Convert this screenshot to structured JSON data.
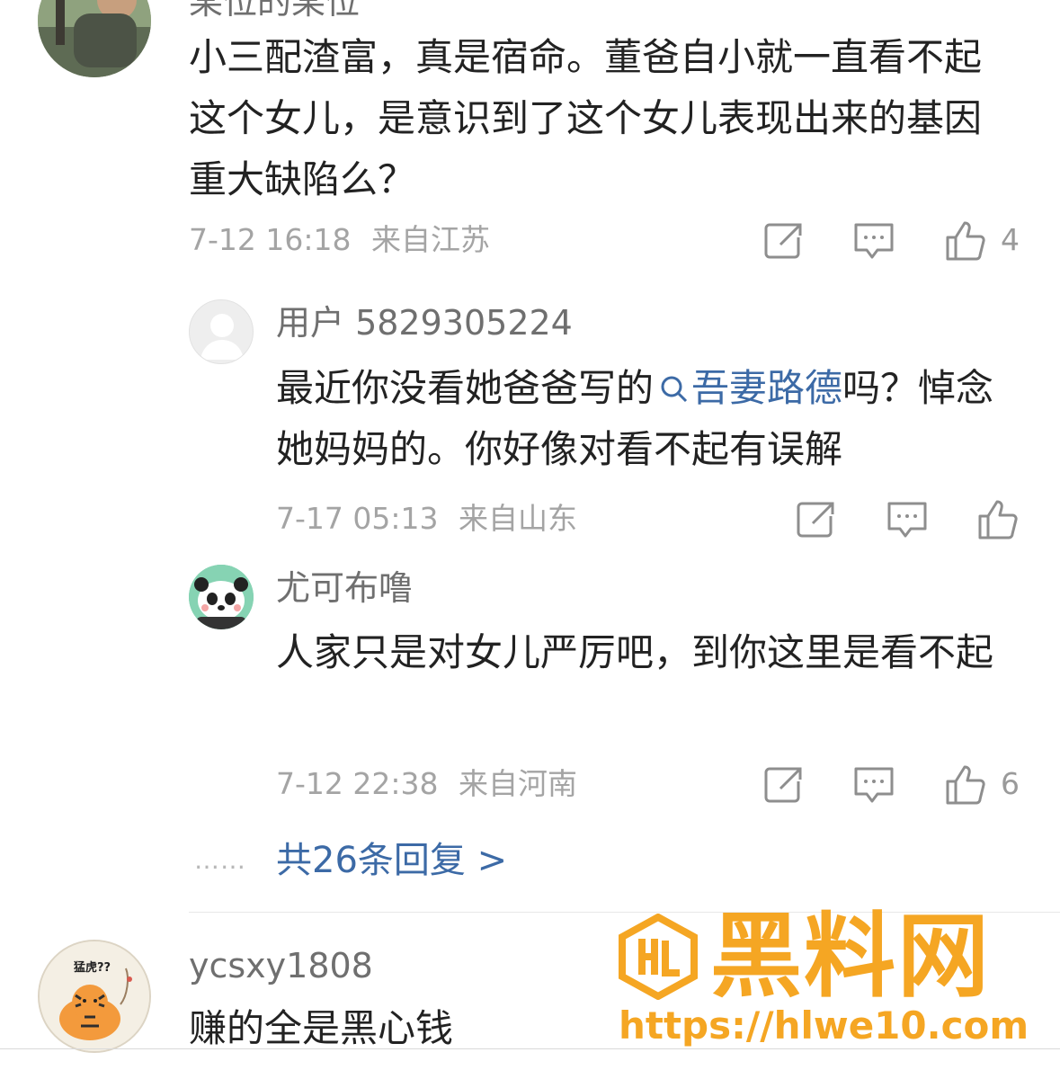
{
  "comments": [
    {
      "author": "某位的某位",
      "text": "小三配渣富，真是宿命。董爸自小就一直看不起这个女儿，是意识到了这个女儿表现出来的基因重大缺陷么？",
      "time": "7-12 16:18",
      "location": "来自江苏",
      "likes": "4"
    },
    {
      "author": "ycsxy1808",
      "text": "赚的全是黑心钱",
      "avatar_caption": "猛虎??"
    }
  ],
  "replies": [
    {
      "author": "用户 5829305224",
      "text_before": "最近你没看她爸爸写的",
      "link_text": "吾妻路德",
      "text_after": "吗？悼念她妈妈的。你好像对看不起有误解",
      "time": "7-17 05:13",
      "location": "来自山东",
      "likes": ""
    },
    {
      "author": "尤可布噜",
      "text": "人家只是对女儿严厉吧，到你这里是看不起",
      "time": "7-12 22:38",
      "location": "来自河南",
      "likes": "6"
    }
  ],
  "more_replies": {
    "dots": "……",
    "label": "共26条回复 >"
  },
  "watermark": {
    "title": "黑料网",
    "url": "https://hlwe10.com",
    "color": "#f5a623"
  },
  "icons": [
    "repost-icon",
    "comment-icon",
    "like-icon",
    "search-icon"
  ]
}
